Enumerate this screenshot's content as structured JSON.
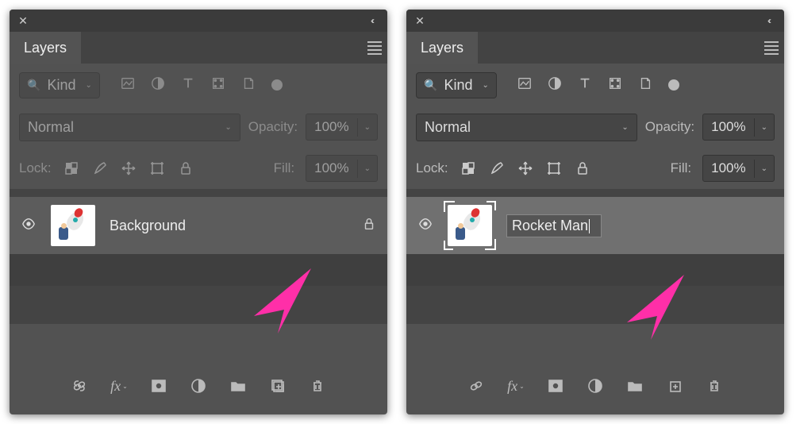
{
  "panels": {
    "left": {
      "tab": "Layers",
      "filter": {
        "kindLabel": "Kind"
      },
      "blend": "Normal",
      "opacity_label": "Opacity:",
      "opacity_value": "100%",
      "lock_label": "Lock:",
      "fill_label": "Fill:",
      "fill_value": "100%",
      "layer": {
        "name": "Background",
        "locked": true,
        "editing": false
      }
    },
    "right": {
      "tab": "Layers",
      "filter": {
        "kindLabel": "Kind"
      },
      "blend": "Normal",
      "opacity_label": "Opacity:",
      "opacity_value": "100%",
      "lock_label": "Lock:",
      "fill_label": "Fill:",
      "fill_value": "100%",
      "layer": {
        "name": "Rocket Man",
        "locked": false,
        "editing": true
      }
    }
  },
  "icons": {
    "close": "✕",
    "collapse": "‹‹",
    "search": "🔍"
  }
}
